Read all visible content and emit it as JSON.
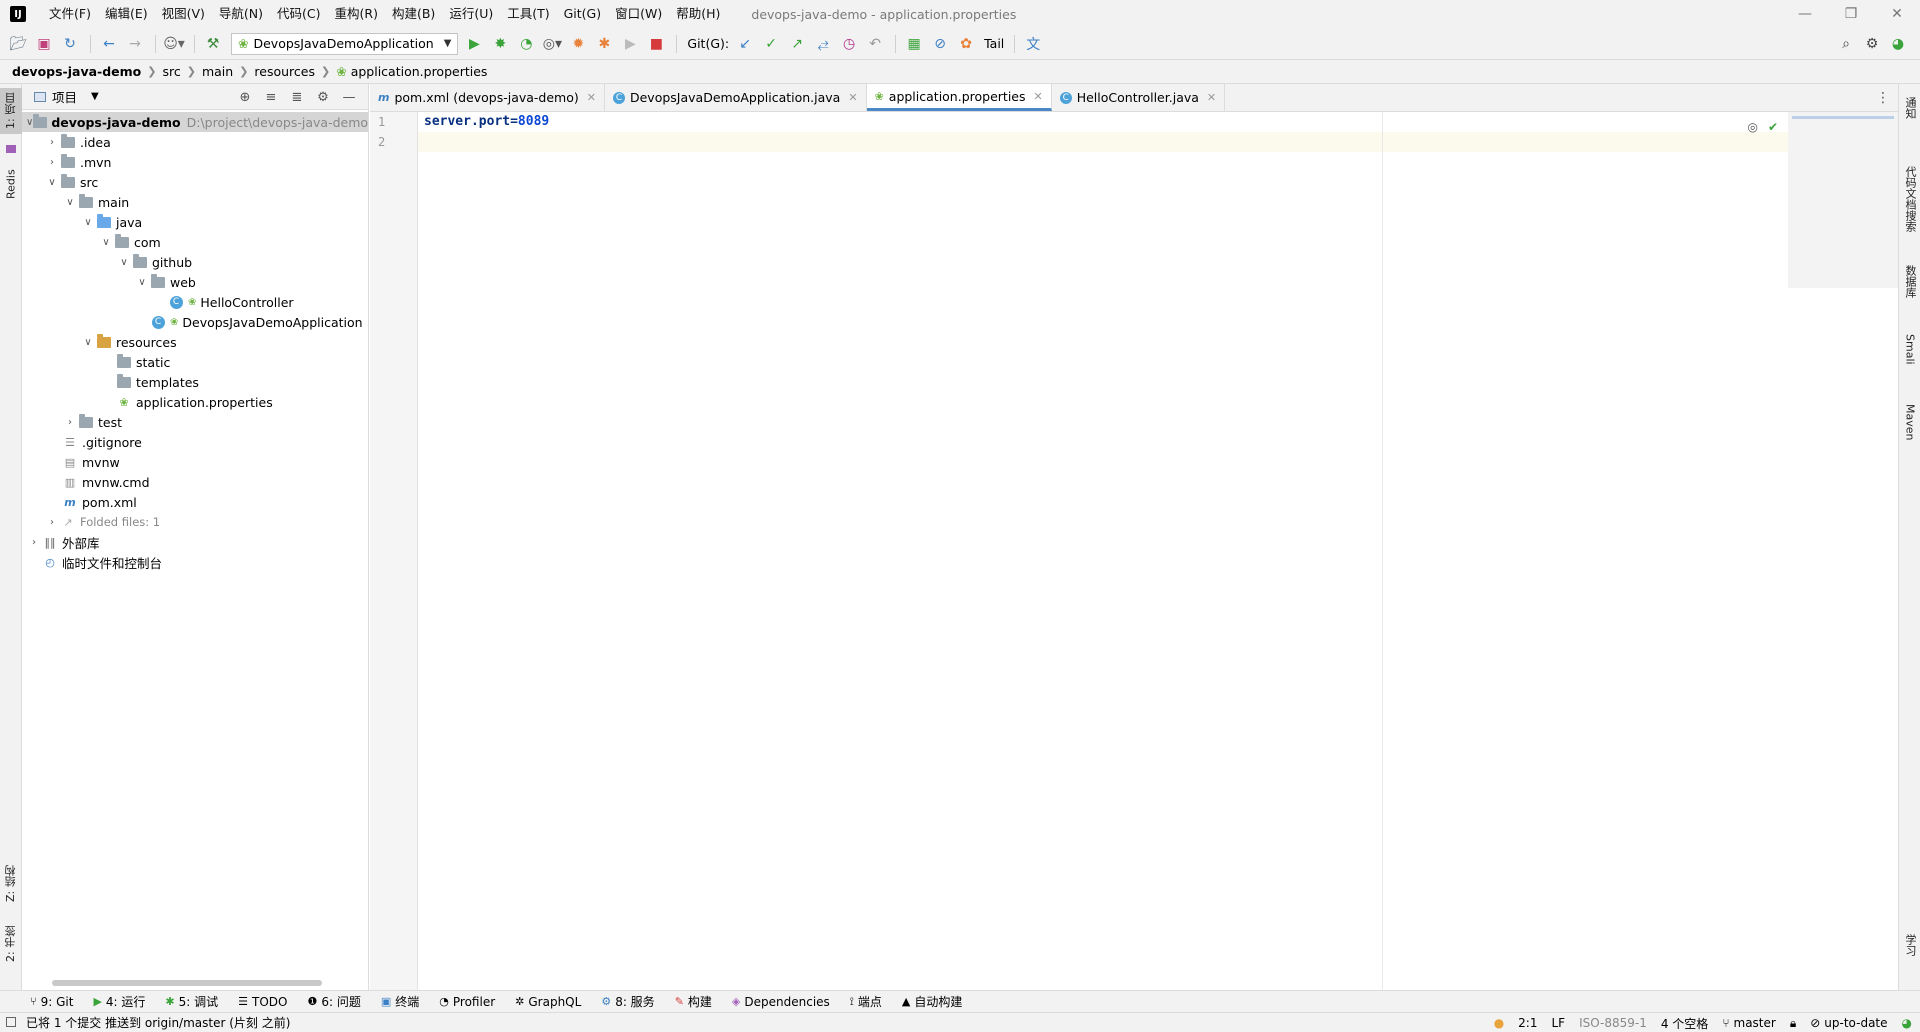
{
  "titlebar": {
    "logo": "IJ",
    "menu": [
      "文件(F)",
      "编辑(E)",
      "视图(V)",
      "导航(N)",
      "代码(C)",
      "重构(R)",
      "构建(B)",
      "运行(U)",
      "工具(T)",
      "Git(G)",
      "窗口(W)",
      "帮助(H)"
    ],
    "window_title": "devops-java-demo - application.properties"
  },
  "toolbar": {
    "run_config": "DevopsJavaDemoApplication",
    "git_label": "Git(G):",
    "tail_label": "Tail"
  },
  "breadcrumb": [
    "devops-java-demo",
    "src",
    "main",
    "resources",
    "application.properties"
  ],
  "left_strip": {
    "project_tab": "1: 项目",
    "redis_tab": "Redis",
    "structure_tab": "Z: 结构",
    "bookmarks_tab": "2: 书签"
  },
  "right_strip": {
    "notifications": "通知",
    "code_review": "代码文档搜索",
    "database": "数据库",
    "smali": "Smali",
    "maven": "Maven",
    "learn": "学习"
  },
  "project_panel": {
    "title": "项目",
    "tree": [
      {
        "label": "devops-java-demo",
        "secondary": "D:\\project\\devops-java-demo"
      },
      {
        "label": ".idea"
      },
      {
        "label": ".mvn"
      },
      {
        "label": "src"
      },
      {
        "label": "main"
      },
      {
        "label": "java"
      },
      {
        "label": "com"
      },
      {
        "label": "github"
      },
      {
        "label": "web"
      },
      {
        "label": "HelloController"
      },
      {
        "label": "DevopsJavaDemoApplication"
      },
      {
        "label": "resources"
      },
      {
        "label": "static"
      },
      {
        "label": "templates"
      },
      {
        "label": "application.properties"
      },
      {
        "label": "test"
      },
      {
        "label": ".gitignore"
      },
      {
        "label": "mvnw"
      },
      {
        "label": "mvnw.cmd"
      },
      {
        "label": "pom.xml"
      },
      {
        "label": "Folded files: 1"
      },
      {
        "label": "外部库"
      },
      {
        "label": "临时文件和控制台"
      }
    ]
  },
  "editor": {
    "tabs": [
      {
        "label": "pom.xml (devops-java-demo)"
      },
      {
        "label": "DevopsJavaDemoApplication.java"
      },
      {
        "label": "application.properties"
      },
      {
        "label": "HelloController.java"
      }
    ],
    "lines": [
      {
        "no": "1",
        "key": "server.port",
        "eq": "=",
        "value": "8089"
      },
      {
        "no": "2",
        "key": "",
        "eq": "",
        "value": ""
      }
    ]
  },
  "bottom_tools": [
    {
      "icon": "⑂",
      "label": "9: Git"
    },
    {
      "icon": "▶",
      "label": "4: 运行"
    },
    {
      "icon": "✱",
      "label": "5: 调试"
    },
    {
      "icon": "☰",
      "label": "TODO"
    },
    {
      "icon": "❶",
      "label": "6: 问题"
    },
    {
      "icon": "▣",
      "label": "终端"
    },
    {
      "icon": "◔",
      "label": "Profiler"
    },
    {
      "icon": "✲",
      "label": "GraphQL"
    },
    {
      "icon": "⚙",
      "label": "8: 服务"
    },
    {
      "icon": "✎",
      "label": "构建"
    },
    {
      "icon": "◈",
      "label": "Dependencies"
    },
    {
      "icon": "⟟",
      "label": "端点"
    },
    {
      "icon": "▲",
      "label": "自动构建"
    }
  ],
  "statusbar": {
    "message": "已将 1 个提交 推送到 origin/master (片刻 之前)",
    "position": "2:1",
    "line_sep": "LF",
    "encoding": "ISO-8859-1",
    "indent": "4 个空格",
    "branch": "master",
    "vcs_state": "up-to-date"
  },
  "colors": {
    "accent": "#4a88c7",
    "run_green": "#3aa33a",
    "stop_red": "#d63a3a"
  }
}
